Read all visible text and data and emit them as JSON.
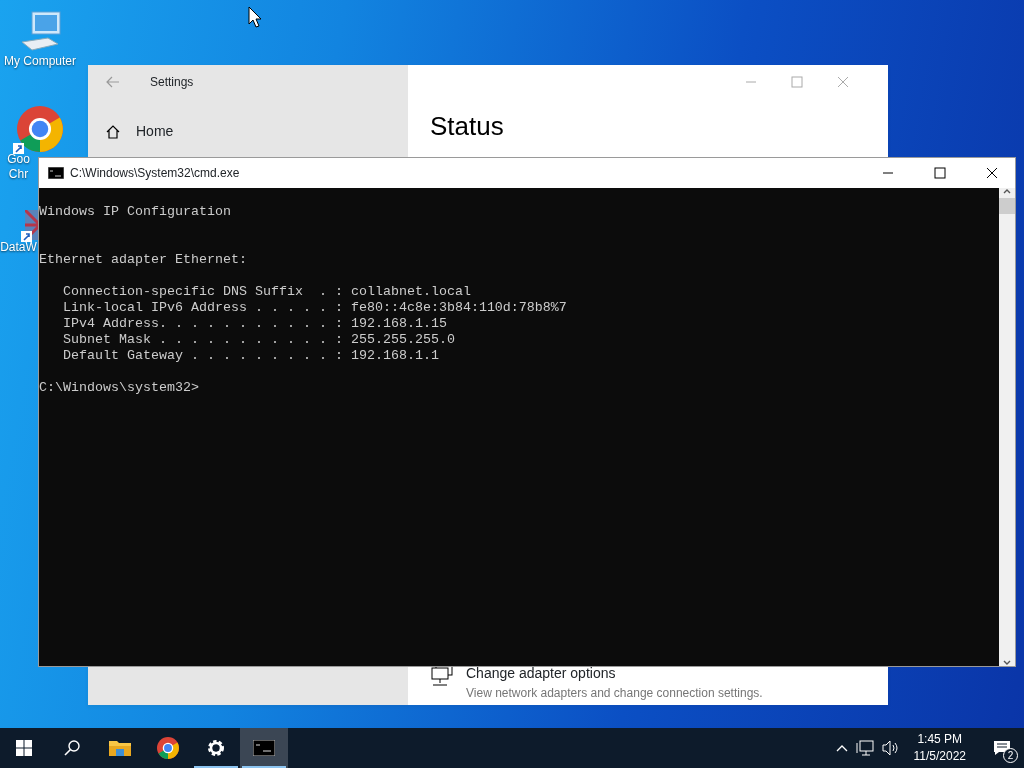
{
  "desktop": {
    "icons": [
      {
        "kind": "computer",
        "shortcut": false,
        "label_lines": [
          "My Computer"
        ]
      },
      {
        "kind": "chrome",
        "shortcut": true,
        "label_lines": [
          "Goo",
          "Chr"
        ]
      },
      {
        "kind": "app",
        "shortcut": true,
        "label_lines": [
          "DataW"
        ]
      }
    ]
  },
  "settings_window": {
    "title": "Settings",
    "nav": [
      {
        "label": "Home"
      }
    ],
    "heading": "Status",
    "link": {
      "title": "Change adapter options",
      "description": "View network adapters and change connection settings."
    }
  },
  "console_window": {
    "title": "C:\\Windows\\System32\\cmd.exe",
    "header": "Windows IP Configuration",
    "adapter": "Ethernet adapter Ethernet:",
    "entries": [
      {
        "label": "Connection-specific DNS Suffix  . :",
        "value": "collabnet.local"
      },
      {
        "label": "Link-local IPv6 Address . . . . . :",
        "value": "fe80::4c8e:3b84:110d:78b8%7"
      },
      {
        "label": "IPv4 Address. . . . . . . . . . . :",
        "value": "192.168.1.15"
      },
      {
        "label": "Subnet Mask . . . . . . . . . . . :",
        "value": "255.255.255.0"
      },
      {
        "label": "Default Gateway . . . . . . . . . :",
        "value": "192.168.1.1"
      }
    ],
    "prompt": "C:\\Windows\\system32>"
  },
  "taskbar": {
    "apps": [
      {
        "kind": "explorer",
        "running": false,
        "selected": false
      },
      {
        "kind": "chrome",
        "running": false,
        "selected": false
      },
      {
        "kind": "settings",
        "running": true,
        "selected": false
      },
      {
        "kind": "cmd",
        "running": true,
        "selected": true
      }
    ],
    "time": "1:45 PM",
    "date": "11/5/2022",
    "notifications": "2"
  }
}
